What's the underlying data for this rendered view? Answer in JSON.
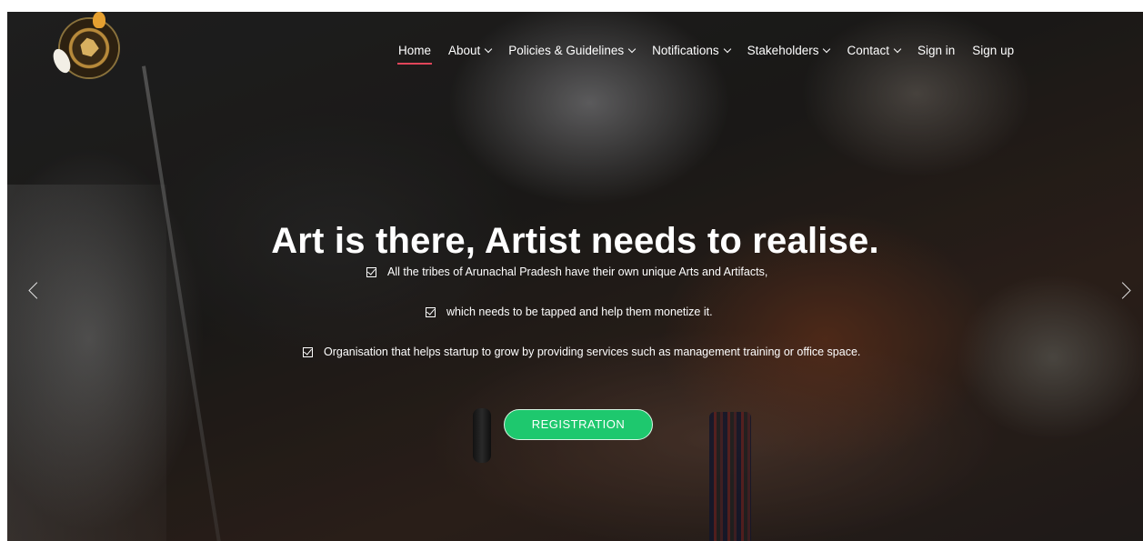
{
  "nav": {
    "items": [
      {
        "label": "Home",
        "active": true,
        "dropdown": false
      },
      {
        "label": "About",
        "active": false,
        "dropdown": true
      },
      {
        "label": "Policies & Guidelines",
        "active": false,
        "dropdown": true
      },
      {
        "label": "Notifications",
        "active": false,
        "dropdown": true
      },
      {
        "label": "Stakeholders",
        "active": false,
        "dropdown": true
      },
      {
        "label": "Contact",
        "active": false,
        "dropdown": true
      },
      {
        "label": "Sign in",
        "active": false,
        "dropdown": false
      },
      {
        "label": "Sign up",
        "active": false,
        "dropdown": false
      }
    ],
    "active_underline_color": "#e0455a"
  },
  "hero": {
    "headline": "Art is there, Artist needs to realise.",
    "bullets": [
      "All the tribes of Arunachal Pradesh have their own unique Arts and Artifacts,",
      "which needs to be tapped and help them monetize it.",
      "Organisation that helps startup to grow by providing services such as management training or office space."
    ],
    "cta_label": "REGISTRATION",
    "cta_color": "#1ec86e"
  },
  "icons": {
    "check": "checkbox-check-icon",
    "prev": "chevron-left-icon",
    "next": "chevron-right-icon",
    "dropdown": "chevron-down-icon"
  }
}
